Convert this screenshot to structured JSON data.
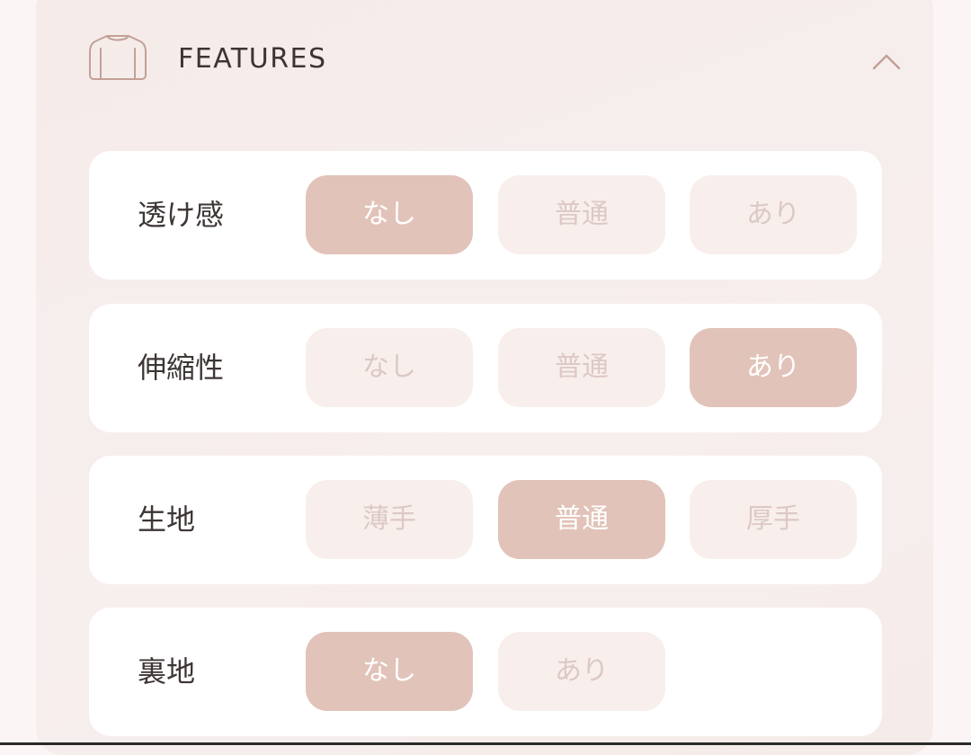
{
  "header": {
    "title": "FEATURES",
    "icon": "shirt-icon",
    "toggle_icon": "chevron-up-icon"
  },
  "colors": {
    "selected_bg": "#e2c3b9",
    "unselected_bg": "#f8efed",
    "unselected_text": "#dcc8c4",
    "label_text": "#3d3634"
  },
  "features": [
    {
      "label": "透け感",
      "options": [
        "なし",
        "普通",
        "あり"
      ],
      "selected": 0
    },
    {
      "label": "伸縮性",
      "options": [
        "なし",
        "普通",
        "あり"
      ],
      "selected": 2
    },
    {
      "label": "生地",
      "options": [
        "薄手",
        "普通",
        "厚手"
      ],
      "selected": 1
    },
    {
      "label": "裏地",
      "options": [
        "なし",
        "あり"
      ],
      "selected": 0
    }
  ]
}
